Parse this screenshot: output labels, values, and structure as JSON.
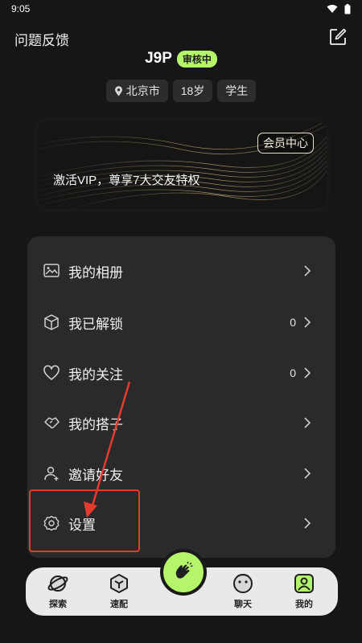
{
  "status_bar": {
    "time": "9:05"
  },
  "header": {
    "feedback_label": "问题反馈"
  },
  "profile": {
    "username": "J9P",
    "badge": "审核中",
    "tags": [
      {
        "icon": "location-pin-icon",
        "label": "北京市"
      },
      {
        "label": "18岁"
      },
      {
        "label": "学生"
      }
    ]
  },
  "vip": {
    "center_label": "会员中心",
    "promo_text": "激活VIP，尊享7大交友特权"
  },
  "menu": {
    "items": [
      {
        "icon": "album-icon",
        "label": "我的相册",
        "count": ""
      },
      {
        "icon": "unlock-box-icon",
        "label": "我已解锁",
        "count": "0"
      },
      {
        "icon": "heart-icon",
        "label": "我的关注",
        "count": "0"
      },
      {
        "icon": "handshake-icon",
        "label": "我的搭子",
        "count": ""
      },
      {
        "icon": "person-add-icon",
        "label": "邀请好友",
        "count": ""
      },
      {
        "icon": "gear-icon",
        "label": "设置",
        "count": ""
      }
    ]
  },
  "bottom_nav": {
    "items": [
      {
        "icon": "planet-icon",
        "label": "探索"
      },
      {
        "icon": "cube-icon",
        "label": "速配"
      },
      {
        "icon": "chat-face-icon",
        "label": "聊天"
      },
      {
        "icon": "profile-icon",
        "label": "我的"
      }
    ],
    "center_icon": "clap-hands-icon"
  },
  "colors": {
    "accent": "#b5f56a",
    "background": "#161616",
    "card": "#2a2a2a",
    "annotation": "#e53b2f"
  }
}
